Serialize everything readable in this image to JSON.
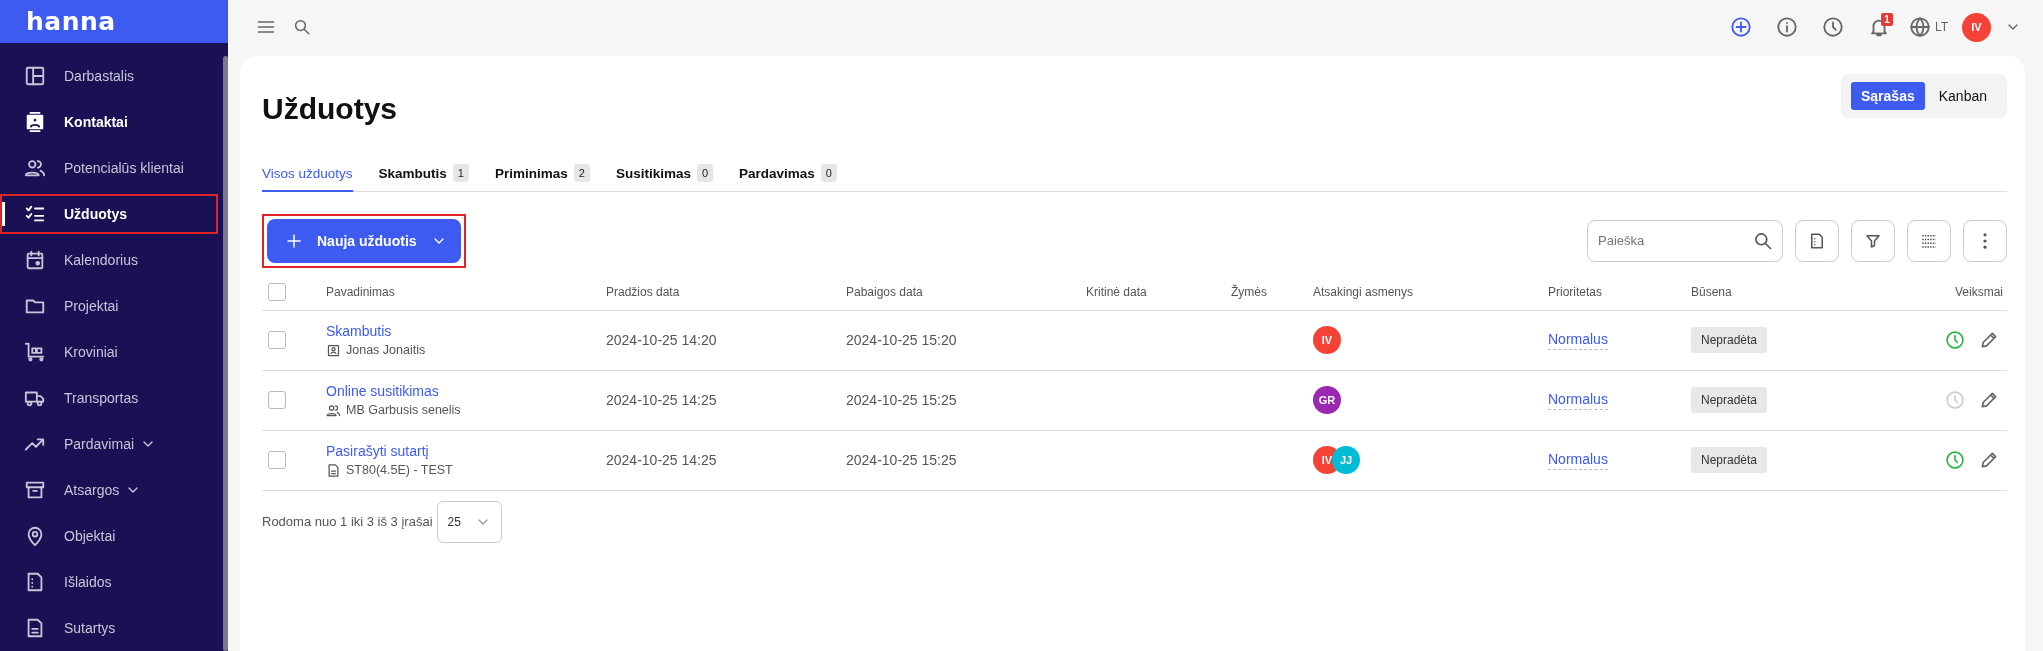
{
  "sidebar": {
    "logo": "hanna",
    "items": [
      {
        "label": "Darbastalis",
        "selected": false,
        "emphasized": false,
        "expandable": false,
        "marked": false
      },
      {
        "label": "Kontaktai",
        "selected": false,
        "emphasized": true,
        "expandable": false,
        "marked": false
      },
      {
        "label": "Potencialūs klientai",
        "selected": false,
        "emphasized": false,
        "expandable": false,
        "marked": false
      },
      {
        "label": "Užduotys",
        "selected": true,
        "emphasized": true,
        "expandable": false,
        "marked": true
      },
      {
        "label": "Kalendorius",
        "selected": false,
        "emphasized": false,
        "expandable": false,
        "marked": false
      },
      {
        "label": "Projektai",
        "selected": false,
        "emphasized": false,
        "expandable": false,
        "marked": false
      },
      {
        "label": "Kroviniai",
        "selected": false,
        "emphasized": false,
        "expandable": false,
        "marked": false
      },
      {
        "label": "Transportas",
        "selected": false,
        "emphasized": false,
        "expandable": false,
        "marked": false
      },
      {
        "label": "Pardavimai",
        "selected": false,
        "emphasized": false,
        "expandable": true,
        "marked": false
      },
      {
        "label": "Atsargos",
        "selected": false,
        "emphasized": false,
        "expandable": true,
        "marked": false
      },
      {
        "label": "Objektai",
        "selected": false,
        "emphasized": false,
        "expandable": false,
        "marked": false
      },
      {
        "label": "Išlaidos",
        "selected": false,
        "emphasized": false,
        "expandable": false,
        "marked": false
      },
      {
        "label": "Sutartys",
        "selected": false,
        "emphasized": false,
        "expandable": false,
        "marked": false
      }
    ]
  },
  "topbar": {
    "notification_count": "1",
    "language": "LT",
    "user_initials": "IV"
  },
  "page": {
    "title": "Užduotys",
    "view_switch": [
      {
        "label": "Sąrašas",
        "selected": true
      },
      {
        "label": "Kanban",
        "selected": false
      }
    ],
    "tabs": [
      {
        "label": "Visos užduotys",
        "selected": true
      },
      {
        "label": "Skambutis",
        "count": "1",
        "selected": false
      },
      {
        "label": "Priminimas",
        "count": "2",
        "selected": false
      },
      {
        "label": "Susitikimas",
        "count": "0",
        "selected": false
      },
      {
        "label": "Pardavimas",
        "count": "0",
        "selected": false
      }
    ],
    "new_button": {
      "label": "Nauja užduotis",
      "marked": true
    },
    "search": {
      "placeholder": "Paieška"
    }
  },
  "table": {
    "select_all_checked": false,
    "columns": [
      "Pavadinimas",
      "Pradžios data",
      "Pabaigos data",
      "Kritinė data",
      "Žymės",
      "Atsakingi asmenys",
      "Prioritetas",
      "Būsena",
      "Veiksmai"
    ],
    "rows": [
      {
        "checked": false,
        "title": "Skambutis",
        "subtitle": "Jonas Jonaitis",
        "kind": "contact",
        "start": "2024-10-25 14:20",
        "end": "2024-10-25 15:20",
        "assignees": [
          {
            "initials": "IV",
            "color": "#f44336"
          }
        ],
        "priority": "Normalus",
        "status": "Nepradėta",
        "timer_active": true
      },
      {
        "checked": false,
        "title": "Online susitikimas",
        "subtitle": "MB Garbusis senelis",
        "kind": "client",
        "start": "2024-10-25 14:25",
        "end": "2024-10-25 15:25",
        "assignees": [
          {
            "initials": "GR",
            "color": "#9c27b0"
          }
        ],
        "priority": "Normalus",
        "status": "Nepradėta",
        "timer_active": false
      },
      {
        "checked": false,
        "title": "Pasirašyti sutartį",
        "subtitle": "ST80(4.5E) - TEST",
        "kind": "document",
        "start": "2024-10-25 14:25",
        "end": "2024-10-25 15:25",
        "assignees": [
          {
            "initials": "IV",
            "color": "#f44336"
          },
          {
            "initials": "JJ",
            "color": "#00bcd4"
          }
        ],
        "priority": "Normalus",
        "status": "Nepradėta",
        "timer_active": true
      }
    ]
  },
  "pagination": {
    "summary": "Rodoma nuo 1 iki 3 iš 3 įrašai",
    "page_size": "25"
  }
}
